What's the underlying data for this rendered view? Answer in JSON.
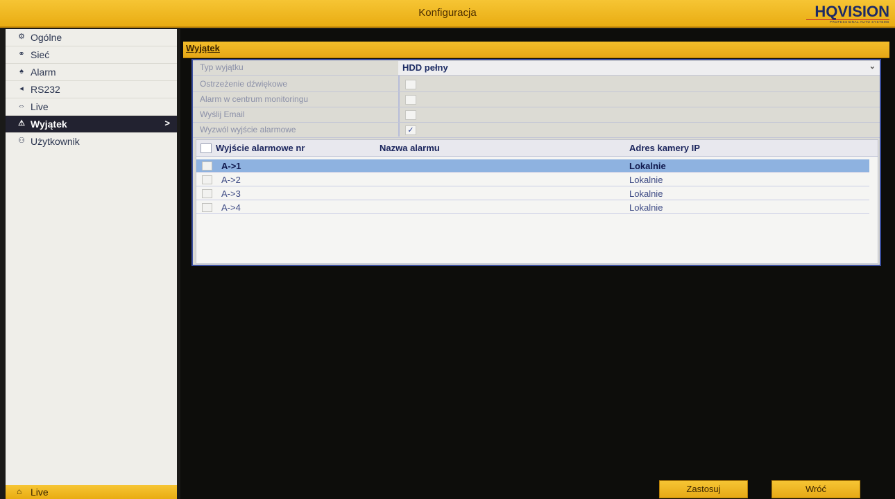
{
  "window": {
    "title": "Konfiguracja",
    "brand": "HQVISION",
    "brand_tagline": "PROFESSIONAL AUTO SYSTEMS"
  },
  "sidebar": {
    "items": [
      {
        "label": "Ogólne",
        "icon": "gear-icon",
        "glyph": "⚙"
      },
      {
        "label": "Sieć",
        "icon": "network-icon",
        "glyph": "⚭"
      },
      {
        "label": "Alarm",
        "icon": "alarm-icon",
        "glyph": "♠"
      },
      {
        "label": "RS232",
        "icon": "serial-port-icon",
        "glyph": "◂"
      },
      {
        "label": "Live",
        "icon": "live-view-icon",
        "glyph": "⇔"
      },
      {
        "label": "Wyjątek",
        "icon": "warning-icon",
        "glyph": "⚠",
        "active": true
      },
      {
        "label": "Użytkownik",
        "icon": "users-icon",
        "glyph": "⚇"
      }
    ],
    "chevron": ">",
    "live_button": {
      "label": "Live",
      "icon": "home-icon",
      "glyph": "⌂"
    }
  },
  "section": {
    "title": "Wyjątek"
  },
  "form": {
    "exception_type": {
      "label": "Typ wyjątku",
      "value": "HDD pełny",
      "arrow": "⌄"
    },
    "options": [
      {
        "label": "Ostrzeżenie dźwiękowe",
        "checked": false
      },
      {
        "label": "Alarm w centrum monitoringu",
        "checked": false
      },
      {
        "label": "Wyślij Email",
        "checked": false
      },
      {
        "label": "Wyzwól wyjście alarmowe",
        "checked": true
      }
    ],
    "check_glyph": "✓"
  },
  "table": {
    "columns": [
      "Wyjście alarmowe nr",
      "Nazwa alarmu",
      "Adres kamery IP"
    ],
    "rows": [
      {
        "output": "A->1",
        "name": "",
        "address": "Lokalnie",
        "selected": true
      },
      {
        "output": "A->2",
        "name": "",
        "address": "Lokalnie",
        "selected": false
      },
      {
        "output": "A->3",
        "name": "",
        "address": "Lokalnie",
        "selected": false
      },
      {
        "output": "A->4",
        "name": "",
        "address": "Lokalnie",
        "selected": false
      }
    ]
  },
  "buttons": {
    "apply": "Zastosuj",
    "back": "Wróć"
  },
  "colors": {
    "accent": "#e9ac12",
    "panel": "#dcdbd4",
    "selection": "#8eb2e0",
    "active_nav": "#222230"
  }
}
